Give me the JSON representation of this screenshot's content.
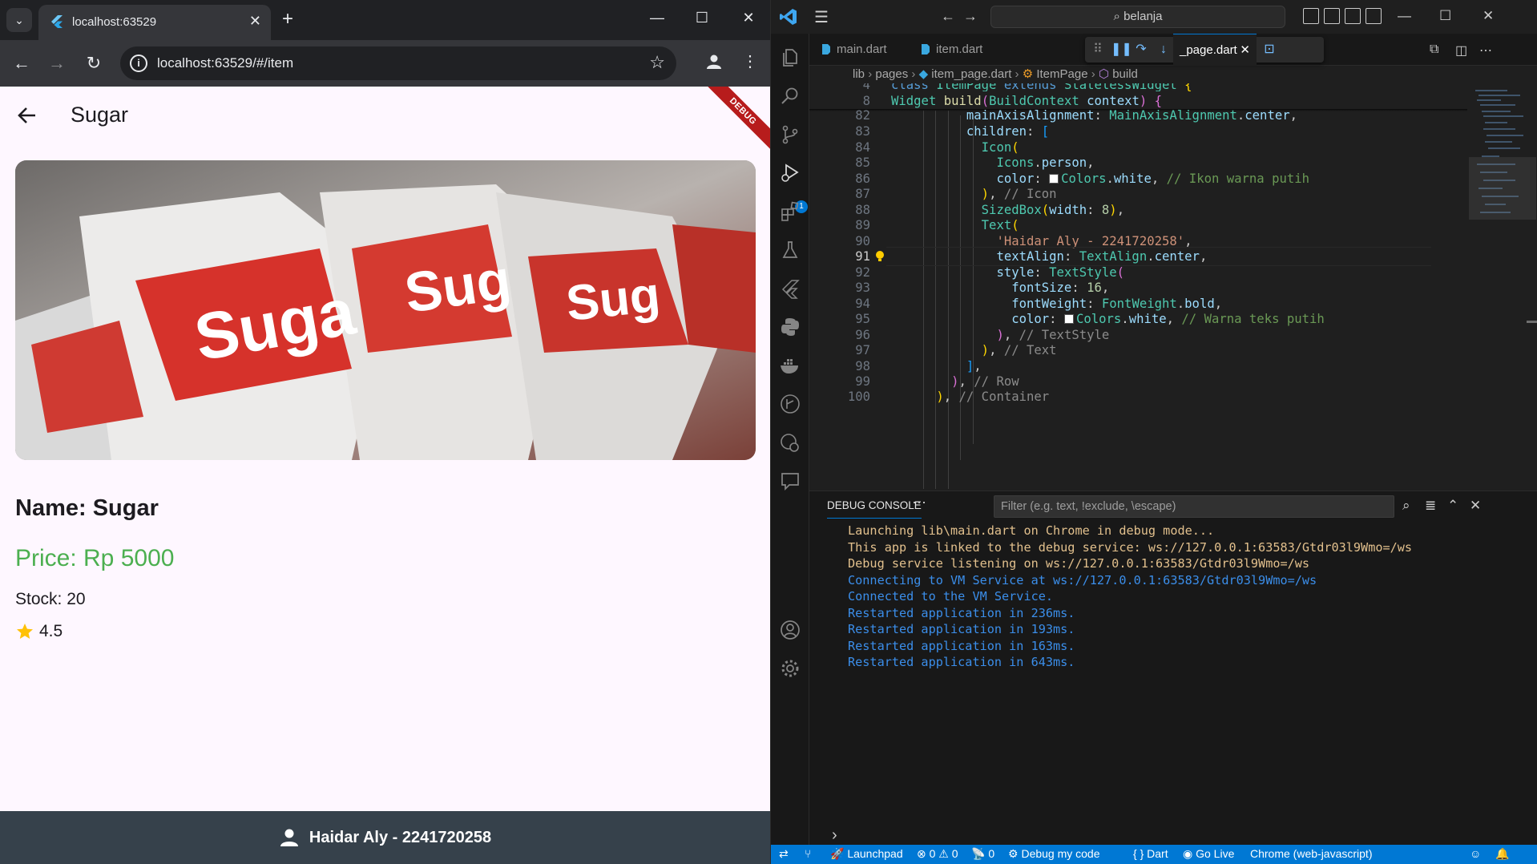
{
  "browser": {
    "tab_title": "localhost:63529",
    "url": "localhost:63529/#/item",
    "app": {
      "debug_banner": "DEBUG",
      "appbar_title": "Sugar",
      "product_name": "Name: Sugar",
      "product_price": "Price: Rp 5000",
      "product_stock": "Stock: 20",
      "product_rating": "4.5",
      "footer_text": "Haidar Aly - 2241720258",
      "price_color": "#4caf50",
      "footer_color": "#36414b"
    }
  },
  "vscode": {
    "search_text": "belanja",
    "tabs": [
      {
        "label": "main.dart"
      },
      {
        "label": "item.dart"
      },
      {
        "label": "_page.dart"
      }
    ],
    "breadcrumb": {
      "parts": [
        "lib",
        "pages",
        "item_page.dart",
        "ItemPage",
        "build"
      ]
    },
    "line_numbers": [
      "4",
      "8",
      "82",
      "83",
      "84",
      "85",
      "86",
      "87",
      "88",
      "89",
      "90",
      "91",
      "92",
      "93",
      "94",
      "95",
      "96",
      "97",
      "98",
      "99",
      "100"
    ],
    "panel": {
      "tab_label": "DEBUG CONSOLE",
      "filter_placeholder": "Filter (e.g. text, !exclude, \\escape)",
      "lines": [
        {
          "text": "Launching lib\\main.dart on Chrome in debug mode...",
          "color": "#e2c08d"
        },
        {
          "text": "This app is linked to the debug service: ws://127.0.0.1:63583/Gtdr03l9Wmo=/ws",
          "color": "#e2c08d"
        },
        {
          "text": "Debug service listening on ws://127.0.0.1:63583/Gtdr03l9Wmo=/ws",
          "color": "#e2c08d"
        },
        {
          "text": "Connecting to VM Service at ws://127.0.0.1:63583/Gtdr03l9Wmo=/ws",
          "color": "#3b8eea"
        },
        {
          "text": "Connected to the VM Service.",
          "color": "#3b8eea"
        },
        {
          "text": "Restarted application in 236ms.",
          "color": "#3b8eea"
        },
        {
          "text": "Restarted application in 193ms.",
          "color": "#3b8eea"
        },
        {
          "text": "Restarted application in 163ms.",
          "color": "#3b8eea"
        },
        {
          "text": "Restarted application in 643ms.",
          "color": "#3b8eea"
        }
      ]
    },
    "statusbar": {
      "launchpad": "Launchpad",
      "errors": "0",
      "warnings": "0",
      "ports": "0",
      "debug": "Debug my code",
      "language": "Dart",
      "golive": "Go Live",
      "device": "Chrome (web-javascript)"
    }
  }
}
